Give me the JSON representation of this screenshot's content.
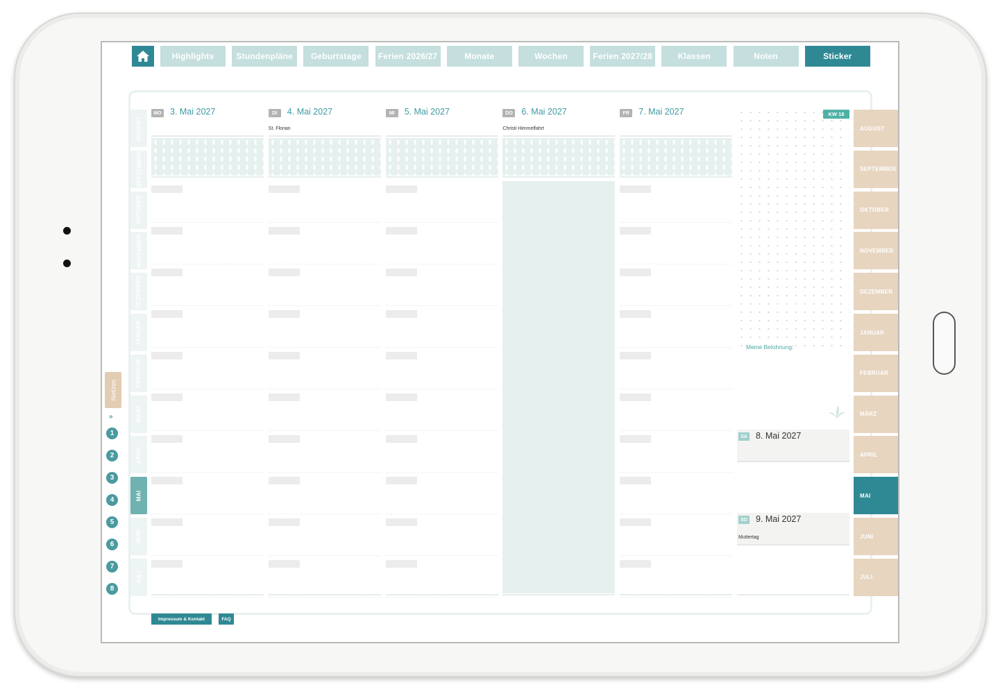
{
  "nav": {
    "home_icon": "home-icon",
    "tabs": [
      {
        "label": "Highlights",
        "active": false
      },
      {
        "label": "Stundenpläne",
        "active": false
      },
      {
        "label": "Geburtstage",
        "active": false
      },
      {
        "label": "Ferien 2026/27",
        "active": false
      },
      {
        "label": "Monate",
        "active": false
      },
      {
        "label": "Wochen",
        "active": false
      },
      {
        "label": "Ferien 2027/28",
        "active": false
      },
      {
        "label": "Klassen",
        "active": false
      },
      {
        "label": "Noten",
        "active": false
      },
      {
        "label": "Sticker",
        "active": true
      }
    ]
  },
  "left_months": [
    "AUGUST",
    "SEPTEMBER",
    "OKTOBER",
    "NOVEMBER",
    "DEZEMBER",
    "JANUAR",
    "FEBRUAR",
    "MÄRZ",
    "APRIL",
    "MAI",
    "JUNI",
    "JULI"
  ],
  "right_months": [
    "AUGUST",
    "SEPTEMBER",
    "OKTOBER",
    "NOVEMBER",
    "DEZEMBER",
    "JANUAR",
    "FEBRUAR",
    "MÄRZ",
    "APRIL",
    "MAI",
    "JUNI",
    "JULI"
  ],
  "active_month": "MAI",
  "notes": {
    "label": "Notizen",
    "collapse_icon": "double-chevron-down-icon",
    "pages": [
      "1",
      "2",
      "3",
      "4",
      "5",
      "6",
      "7",
      "8"
    ]
  },
  "week": {
    "label": "KW 18",
    "days": [
      {
        "abbr": "MO",
        "date": "3. Mai 2027",
        "holiday": ""
      },
      {
        "abbr": "DI",
        "date": "4. Mai 2027",
        "holiday": "St. Florian"
      },
      {
        "abbr": "MI",
        "date": "5. Mai 2027",
        "holiday": ""
      },
      {
        "abbr": "DO",
        "date": "6. Mai 2027",
        "holiday": "Christi Himmelfahrt"
      },
      {
        "abbr": "FR",
        "date": "7. Mai 2027",
        "holiday": ""
      }
    ],
    "reward_label": "Meine Belohnung:",
    "weekend": [
      {
        "abbr": "SA",
        "date": "8. Mai 2027",
        "holiday": ""
      },
      {
        "abbr": "SO",
        "date": "9. Mai 2027",
        "holiday": "Muttertag"
      }
    ]
  },
  "footer": {
    "imprint": "Impressum & Kontakt",
    "faq": "FAQ"
  },
  "colors": {
    "primary": "#2f8994",
    "tab_inactive": "#c4dfdd",
    "month_tab": "#e7d5c0",
    "accent_green": "#4fb1a5"
  }
}
